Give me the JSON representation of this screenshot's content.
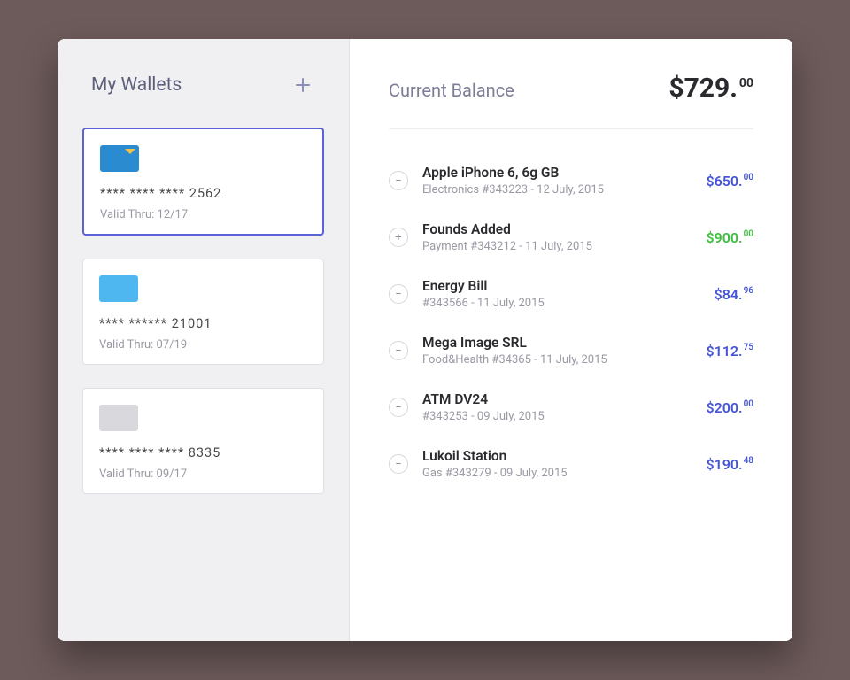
{
  "sidebar": {
    "title": "My Wallets",
    "add_icon": "plus-icon"
  },
  "wallets": [
    {
      "color": "#2a8bd0",
      "accent": true,
      "number": "**** **** **** 2562",
      "valid": "Valid Thru: 12/17",
      "selected": true
    },
    {
      "color": "#4fb7ef",
      "accent": false,
      "number": "**** ****** 21001",
      "valid": "Valid Thru: 07/19",
      "selected": false
    },
    {
      "color": "#d9d9dd",
      "accent": false,
      "number": "**** **** **** 8335",
      "valid": "Valid Thru: 09/17",
      "selected": false
    }
  ],
  "balance": {
    "label": "Current Balance",
    "currency": "$",
    "whole": "729",
    "cents": "00"
  },
  "transactions": [
    {
      "type": "minus",
      "title": "Apple iPhone 6, 6g GB",
      "sub": "Electronics #343223  - 12 July, 2015",
      "currency": "$",
      "whole": "650",
      "cents": "00",
      "color": "blue"
    },
    {
      "type": "plus",
      "title": "Founds Added",
      "sub": "Payment  #343212  - 11 July, 2015",
      "currency": "$",
      "whole": "900",
      "cents": "00",
      "color": "green"
    },
    {
      "type": "minus",
      "title": "Energy Bill",
      "sub": "#343566  - 11 July, 2015",
      "currency": "$",
      "whole": "84",
      "cents": "96",
      "color": "blue"
    },
    {
      "type": "minus",
      "title": "Mega Image SRL",
      "sub": "Food&Health #34365  - 11 July, 2015",
      "currency": "$",
      "whole": "112",
      "cents": "75",
      "color": "blue"
    },
    {
      "type": "minus",
      "title": "ATM DV24",
      "sub": " #343253  - 09 July, 2015",
      "currency": "$",
      "whole": "200",
      "cents": "00",
      "color": "blue"
    },
    {
      "type": "minus",
      "title": "Lukoil Station",
      "sub": "Gas #343279  - 09 July, 2015",
      "currency": "$",
      "whole": "190",
      "cents": "48",
      "color": "blue"
    }
  ]
}
